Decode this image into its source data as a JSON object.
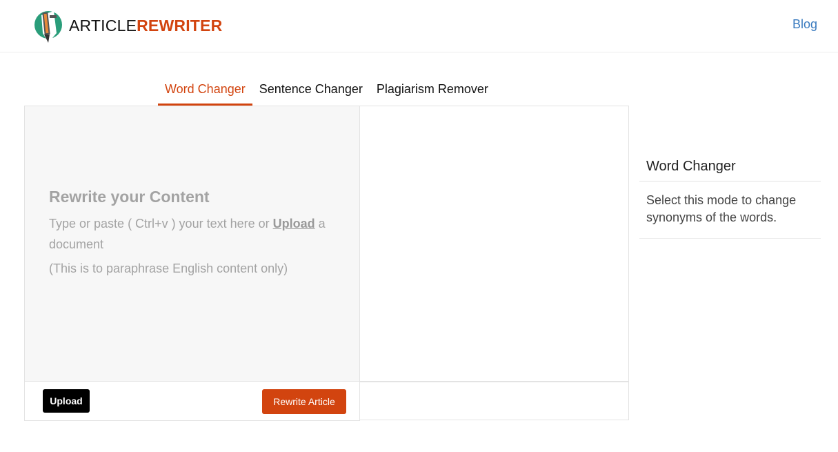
{
  "header": {
    "logo_part1": "ARTICLE",
    "logo_part2": "REWRITER",
    "blog_label": "Blog"
  },
  "tabs": [
    {
      "label": "Word Changer",
      "active": true
    },
    {
      "label": "Sentence Changer",
      "active": false
    },
    {
      "label": "Plagiarism Remover",
      "active": false
    }
  ],
  "editor": {
    "placeholder_title": "Rewrite your Content",
    "placeholder_prefix": "Type or paste ( Ctrl+v ) your text here or ",
    "placeholder_upload_link": "Upload",
    "placeholder_suffix": " a document",
    "placeholder_note": "(This is to paraphrase English content only)",
    "upload_button": "Upload",
    "rewrite_button": "Rewrite Article"
  },
  "sidebar": {
    "title": "Word Changer",
    "description": "Select this mode to change synonyms of the words."
  },
  "colors": {
    "accent": "#d2440f",
    "link": "#3a7bbf"
  },
  "icons": {
    "logo": "pencil-document-icon"
  }
}
